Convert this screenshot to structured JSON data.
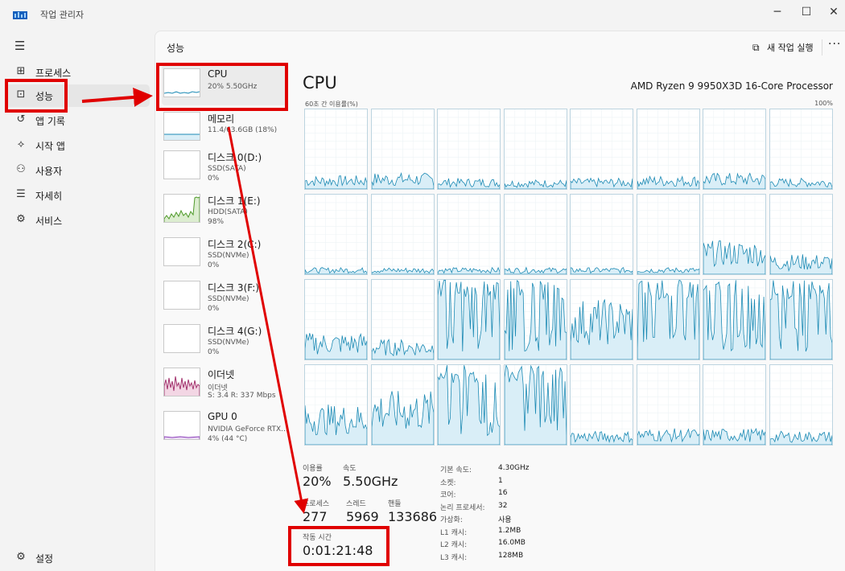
{
  "window": {
    "title": "작업 관리자",
    "minimize": "─",
    "maximize": "☐",
    "close": "✕"
  },
  "nav": {
    "items": [
      {
        "label": "프로세스",
        "icon": "processes-icon",
        "glyph": "⊞"
      },
      {
        "label": "성능",
        "icon": "performance-icon",
        "glyph": "⊡"
      },
      {
        "label": "앱 기록",
        "icon": "app-history-icon",
        "glyph": "↺"
      },
      {
        "label": "시작 앱",
        "icon": "startup-apps-icon",
        "glyph": "⟡"
      },
      {
        "label": "사용자",
        "icon": "users-icon",
        "glyph": "⚇"
      },
      {
        "label": "자세히",
        "icon": "details-icon",
        "glyph": "☰"
      },
      {
        "label": "서비스",
        "icon": "services-icon",
        "glyph": "⚙"
      }
    ],
    "settings": "설정"
  },
  "header": {
    "title": "성능",
    "new_task": "새 작업 실행",
    "more": "···"
  },
  "devices": [
    {
      "name": "CPU",
      "sub1": "20% 5.50GHz",
      "sub2": ""
    },
    {
      "name": "메모리",
      "sub1": "11.4/63.6GB (18%)",
      "sub2": ""
    },
    {
      "name": "디스크 0(D:)",
      "sub1": "SSD(SATA)",
      "sub2": "0%"
    },
    {
      "name": "디스크 1(E:)",
      "sub1": "HDD(SATA)",
      "sub2": "98%"
    },
    {
      "name": "디스크 2(C:)",
      "sub1": "SSD(NVMe)",
      "sub2": "0%"
    },
    {
      "name": "디스크 3(F:)",
      "sub1": "SSD(NVMe)",
      "sub2": "0%"
    },
    {
      "name": "디스크 4(G:)",
      "sub1": "SSD(NVMe)",
      "sub2": "0%"
    },
    {
      "name": "이더넷",
      "sub1": "이더넷",
      "sub2": "S: 3.4 R: 337 Mbps"
    },
    {
      "name": "GPU 0",
      "sub1": "NVIDIA GeForce RTX...",
      "sub2": "4% (44 °C)"
    }
  ],
  "cpu": {
    "title": "CPU",
    "model": "AMD Ryzen 9 9950X3D 16-Core Processor",
    "axis_left": "60초 간 이용률(%)",
    "axis_right": "100%",
    "core_levels": [
      0.1,
      0.12,
      0.08,
      0.07,
      0.08,
      0.1,
      0.12,
      0.08,
      0.05,
      0.05,
      0.05,
      0.05,
      0.05,
      0.05,
      0.25,
      0.15,
      0.2,
      0.15,
      0.8,
      0.85,
      0.45,
      0.6,
      0.85,
      0.75,
      0.3,
      0.4,
      0.75,
      0.8,
      0.1,
      0.12,
      0.12,
      0.1
    ],
    "stats": {
      "util_label": "이용률",
      "util_value": "20%",
      "speed_label": "속도",
      "speed_value": "5.50GHz",
      "proc_label": "프로세스",
      "proc_value": "277",
      "thread_label": "스레드",
      "thread_value": "5969",
      "handle_label": "핸들",
      "handle_value": "133686",
      "uptime_label": "작동 시간",
      "uptime_value": "0:01:21:48"
    },
    "info": [
      {
        "k": "기본 속도:",
        "v": "4.30GHz"
      },
      {
        "k": "소켓:",
        "v": "1"
      },
      {
        "k": "코어:",
        "v": "16"
      },
      {
        "k": "논리 프로세서:",
        "v": "32"
      },
      {
        "k": "가상화:",
        "v": "사용"
      },
      {
        "k": "L1 캐시:",
        "v": "1.2MB"
      },
      {
        "k": "L2 캐시:",
        "v": "16.0MB"
      },
      {
        "k": "L3 캐시:",
        "v": "128MB"
      }
    ]
  },
  "colors": {
    "accent": "#005fb8",
    "cpu_line": "#1c8ab4",
    "cpu_fill": "#d9eef7",
    "disk": "#4f9a2a",
    "net": "#a3336e",
    "gpu": "#8a3bb8",
    "annotation": "#e00000"
  }
}
